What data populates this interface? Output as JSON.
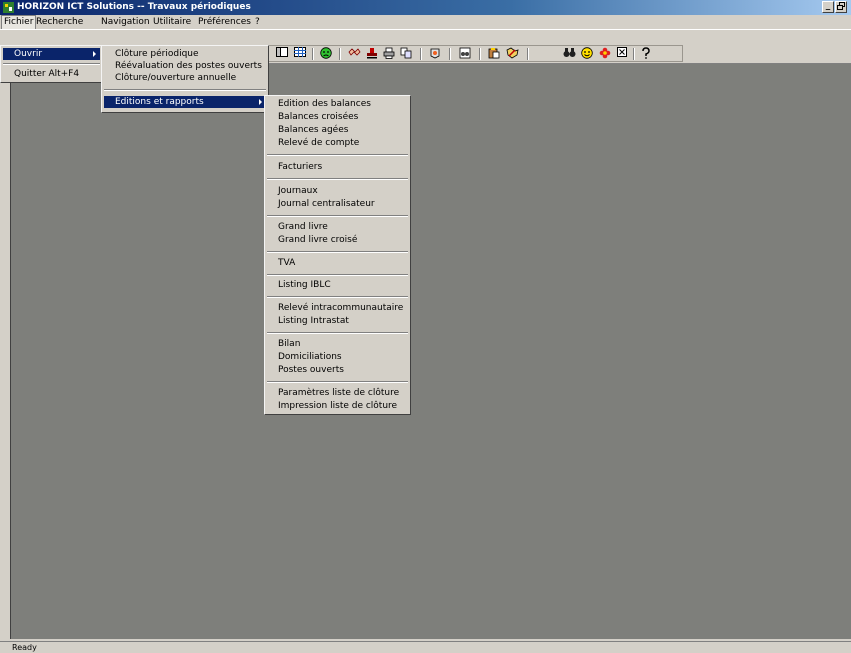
{
  "window": {
    "title": "HORIZON ICT Solutions -- Travaux périodiques",
    "controls": [
      "_",
      "ó"
    ]
  },
  "menubar": [
    "Fichier",
    "Recherche",
    "Navigation",
    "Utilitaire",
    "Préférences",
    "?"
  ],
  "file_menu": {
    "items": [
      "Ouvrir",
      "Quitter  Alt+F4"
    ]
  },
  "ouvrir_menu": {
    "items": [
      "Clôture périodique",
      "Réévaluation des postes ouverts",
      "Clôture/ouverture annuelle",
      "Editions et rapports"
    ]
  },
  "editions_menu": {
    "items": [
      "Edition des balances",
      "Balances croisées",
      "Balances agées",
      "Relevé de compte",
      "Facturiers",
      "Journaux",
      "Journal centralisateur",
      "Grand livre",
      "Grand livre croisé",
      "TVA",
      "Listing IBLC",
      "Relevé intracommunautaire",
      "Listing Intrastat",
      "Bilan",
      "Domiciliations",
      "Postes ouverts",
      "Paramètres liste de clôture",
      "Impression liste de clôture"
    ]
  },
  "toolbar_icons": [
    "window-icon",
    "grid-icon",
    "green-face-icon",
    "handshake-icon",
    "stamp-icon",
    "printer-icon",
    "copy-icon",
    "palette-icon",
    "binoculars-doc-icon",
    "paste-icon",
    "tools-icon",
    "binoculars-icon",
    "smiley-icon",
    "flower-icon",
    "close-box-icon",
    "help-icon"
  ],
  "status": {
    "text": "Ready"
  },
  "colors": {
    "workspace": "#7e7f7b",
    "selection": "#0a246a",
    "chrome": "#d4d0c8"
  }
}
